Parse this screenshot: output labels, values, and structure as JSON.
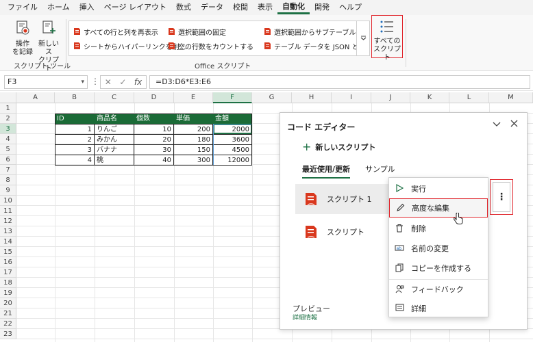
{
  "menu": {
    "tabs": [
      "ファイル",
      "ホーム",
      "挿入",
      "ページ レイアウト",
      "数式",
      "データ",
      "校閲",
      "表示",
      "自動化",
      "開発",
      "ヘルプ"
    ],
    "active_tab": "自動化"
  },
  "ribbon": {
    "record_label_1": "操作",
    "record_label_2": "を記録",
    "new_script_label_1": "新しいス",
    "new_script_label_2": "クリプト",
    "group_script_tools": "スクリプト ツール",
    "gallery": [
      "すべての行と列を再表示",
      "選択範囲の固定",
      "選択範囲からサブテーブルを…",
      "シートからハイパーリンクを削…",
      "空の行数をカウントする",
      "テーブル データを JSON と…"
    ],
    "group_office_scripts": "Office スクリプト",
    "all_scripts_1": "すべての",
    "all_scripts_2": "スクリプト"
  },
  "formula_bar": {
    "name_box": "F3",
    "formula": "=D3:D6*E3:E6"
  },
  "grid": {
    "columns": [
      "A",
      "B",
      "C",
      "D",
      "E",
      "F",
      "G",
      "H",
      "I",
      "J",
      "K",
      "L",
      "M"
    ],
    "selected_column": "F",
    "rows": [
      "1",
      "2",
      "3",
      "4",
      "5",
      "6",
      "7",
      "8",
      "9",
      "10",
      "11",
      "12",
      "13",
      "14",
      "15",
      "16",
      "17",
      "18",
      "19",
      "20",
      "21",
      "22",
      "23"
    ],
    "selected_row": "3",
    "table": {
      "headers": [
        "ID",
        "商品名",
        "個数",
        "単価",
        "金額"
      ],
      "rows": [
        [
          "1",
          "りんご",
          "10",
          "200",
          "2000"
        ],
        [
          "2",
          "みかん",
          "20",
          "180",
          "3600"
        ],
        [
          "3",
          "バナナ",
          "30",
          "150",
          "4500"
        ],
        [
          "4",
          "桃",
          "40",
          "300",
          "12000"
        ]
      ]
    }
  },
  "code_editor": {
    "title": "コード エディター",
    "new_script": "新しいスクリプト",
    "tab_recent": "最近使用/更新",
    "tab_sample": "サンプル",
    "scripts": [
      "スクリプト 1",
      "スクリプト"
    ],
    "preview": "プレビュー",
    "preview_link": "詳細情報"
  },
  "context_menu": {
    "items": [
      "実行",
      "高度な編集",
      "削除",
      "名前の変更",
      "コピーを作成する",
      "フィードバック",
      "詳細"
    ],
    "highlighted": "高度な編集"
  },
  "colors": {
    "accent": "#1e7145",
    "table_header": "#1b6b37",
    "highlight_box": "#e0242b",
    "script_icon": "#d9381e"
  }
}
